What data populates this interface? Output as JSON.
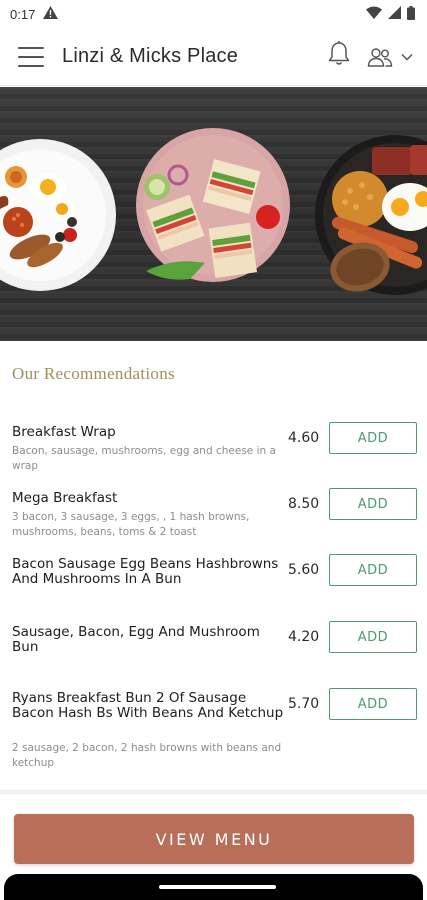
{
  "status_bar": {
    "time": "0:17"
  },
  "app_bar": {
    "title": "Linzi & Micks Place"
  },
  "icons": {
    "menu": "hamburger-menu-icon",
    "bell": "bell-icon",
    "users": "users-icon",
    "chevron": "chevron-down-icon"
  },
  "colors": {
    "accent": "#b86e58",
    "add_green": "#4f9a6f",
    "section_gold": "#a08e5e"
  },
  "section": {
    "title": "Our Recommendations"
  },
  "items": [
    {
      "name": "Breakfast Wrap",
      "description": "Bacon, sausage, mushrooms, egg and cheese in a wrap",
      "price": "4.60",
      "add_label": "ADD"
    },
    {
      "name": "Mega Breakfast",
      "description": "3 bacon, 3 sausage, 3 eggs, , 1  hash browns, mushrooms, beans, toms & 2 toast",
      "price": "8.50",
      "add_label": "ADD"
    },
    {
      "name": "Bacon Sausage Egg Beans Hashbrowns And Mushrooms In A Bun",
      "description": "",
      "price": "5.60",
      "add_label": "ADD"
    },
    {
      "name": "Sausage, Bacon, Egg And Mushroom Bun",
      "description": "",
      "price": "4.20",
      "add_label": "ADD"
    },
    {
      "name": "Ryans Breakfast Bun 2 Of Sausage Bacon Hash Bs With Beans And Ketchup",
      "description": "2 sausage, 2 bacon, 2 hash browns with beans and ketchup",
      "price": "5.70",
      "add_label": "ADD"
    }
  ],
  "footer": {
    "view_menu_label": "VIEW MENU"
  }
}
